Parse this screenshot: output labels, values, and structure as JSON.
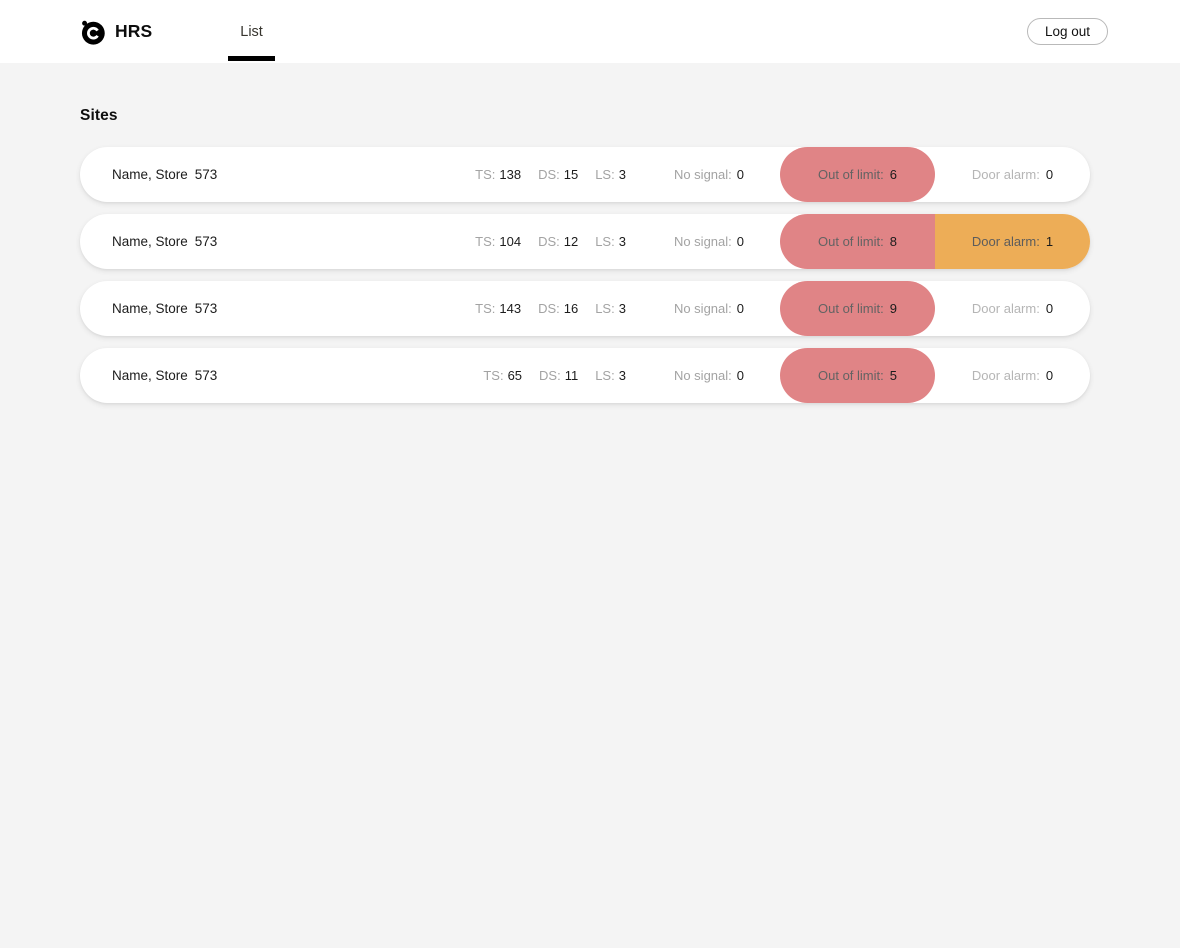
{
  "header": {
    "brand_name": "HRS",
    "logo_icon": "circle-c-logo-icon",
    "tabs": [
      {
        "label": "List",
        "active": true
      }
    ],
    "logout_label": "Log out"
  },
  "main": {
    "page_title": "Sites",
    "labels": {
      "ts": "TS:",
      "ds": "DS:",
      "ls": "LS:",
      "no_signal": "No signal:",
      "out_of_limit": "Out of limit:",
      "door_alarm": "Door alarm:"
    },
    "rows": [
      {
        "name": "Name, Store",
        "store_no": "573",
        "ts": "138",
        "ds": "15",
        "ls": "3",
        "no_signal": "0",
        "out_of_limit": "6",
        "door_alarm": "0",
        "door_alarm_active": false
      },
      {
        "name": "Name, Store",
        "store_no": "573",
        "ts": "104",
        "ds": "12",
        "ls": "3",
        "no_signal": "0",
        "out_of_limit": "8",
        "door_alarm": "1",
        "door_alarm_active": true
      },
      {
        "name": "Name, Store",
        "store_no": "573",
        "ts": "143",
        "ds": "16",
        "ls": "3",
        "no_signal": "0",
        "out_of_limit": "9",
        "door_alarm": "0",
        "door_alarm_active": false
      },
      {
        "name": "Name, Store",
        "store_no": "573",
        "ts": "65",
        "ds": "11",
        "ls": "3",
        "no_signal": "0",
        "out_of_limit": "5",
        "door_alarm": "0",
        "door_alarm_active": false
      }
    ]
  },
  "colors": {
    "page_background": "#f4f4f4",
    "header_background": "#ffffff",
    "card_background": "#ffffff",
    "out_of_limit_pill": "#e08486",
    "door_alarm_pill": "#edad57",
    "tab_underline": "#000000",
    "muted_text": "#a3a3a3"
  }
}
